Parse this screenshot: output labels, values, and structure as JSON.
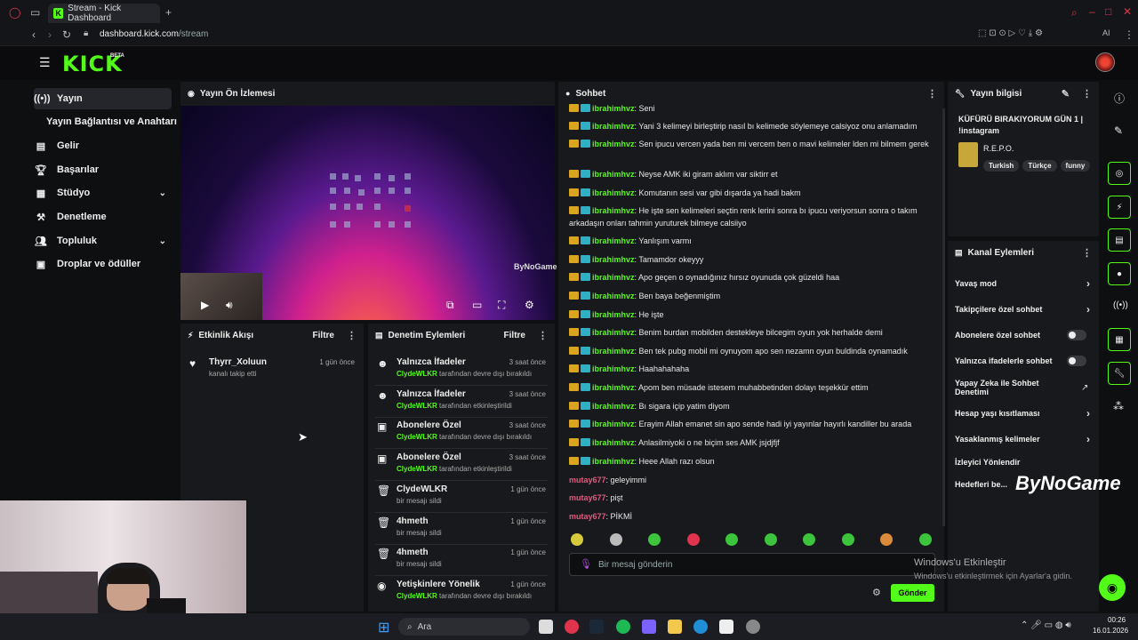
{
  "browser": {
    "tab_title": "Stream - Kick Dashboard",
    "url_domain": "dashboard.kick.com",
    "url_path": "/stream"
  },
  "header": {
    "logo": "KICK",
    "badge": "BETA"
  },
  "sidebar": {
    "items": [
      {
        "label": "Yayın",
        "icon": "broadcast-icon",
        "active": true
      },
      {
        "label": "Yayın Bağlantısı ve Anahtarı",
        "icon": "",
        "active": false
      },
      {
        "label": "Gelir",
        "icon": "chart-icon",
        "active": false
      },
      {
        "label": "Başarılar",
        "icon": "trophy-icon",
        "active": false
      },
      {
        "label": "Stüdyo",
        "icon": "studio-icon",
        "active": false
      },
      {
        "label": "Denetleme",
        "icon": "hammer-icon",
        "active": false
      },
      {
        "label": "Topluluk",
        "icon": "community-icon",
        "active": false
      },
      {
        "label": "Droplar ve ödüller",
        "icon": "gift-icon",
        "active": false
      }
    ]
  },
  "preview": {
    "title": "Yayın Ön İzlemesi",
    "watermark": "ByNoGame"
  },
  "activity": {
    "title": "Etkinlik Akışı",
    "filter_label": "Filtre",
    "items": [
      {
        "user": "Thyrr_Xoluun",
        "desc": "kanalı takip etti",
        "time": "1 gün önce",
        "icon": "heart-icon"
      }
    ]
  },
  "moderation": {
    "title": "Denetim Eylemleri",
    "filter_label": "Filtre",
    "items": [
      {
        "title": "Yalnızca İfadeler",
        "by": "ClydeWLKR",
        "action": "tarafından devre dışı bırakıldı",
        "time": "3 saat önce",
        "icon": "smiley-icon"
      },
      {
        "title": "Yalnızca İfadeler",
        "by": "ClydeWLKR",
        "action": "tarafından etkinleştirildi",
        "time": "3 saat önce",
        "icon": "smiley-icon"
      },
      {
        "title": "Abonelere Özel",
        "by": "ClydeWLKR",
        "action": "tarafından devre dışı bırakıldı",
        "time": "3 saat önce",
        "icon": "gift-icon"
      },
      {
        "title": "Abonelere Özel",
        "by": "ClydeWLKR",
        "action": "tarafından etkinleştirildi",
        "time": "3 saat önce",
        "icon": "gift-icon"
      },
      {
        "title": "ClydeWLKR",
        "by": "",
        "action": "bir mesajı sildi",
        "time": "1 gün önce",
        "icon": "trash-icon"
      },
      {
        "title": "4hmeth",
        "by": "",
        "action": "bir mesajı sildi",
        "time": "1 gün önce",
        "icon": "trash-icon"
      },
      {
        "title": "4hmeth",
        "by": "",
        "action": "bir mesajı sildi",
        "time": "1 gün önce",
        "icon": "trash-icon"
      },
      {
        "title": "Yetişkinlere Yönelik",
        "by": "ClydeWLKR",
        "action": "tarafından devre dışı bırakıldı",
        "time": "1 gün önce",
        "icon": "eye-icon"
      }
    ]
  },
  "chat": {
    "title": "Sohbet",
    "input_placeholder": "Bir mesaj gönderin",
    "send_label": "Gönder",
    "messages": [
      {
        "user": "ibrahimhvz",
        "text": "Seni",
        "badges": true
      },
      {
        "user": "ibrahimhvz",
        "text": "Yani 3 kelimeyi birleştirip nasıl bı kelimede söylemeye calsiyoz onu anlamadım",
        "badges": true
      },
      {
        "user": "ibrahimhvz",
        "text": "Sen ipucu vercen yada ben mi vercem ben o mavi kelimeler lden mi bilmem gerek",
        "badges": true
      },
      {
        "user": "ibrahimhvz",
        "text": "Neyse AMK iki giram aklım var siktirr et",
        "badges": true
      },
      {
        "user": "ibrahimhvz",
        "text": "Komutanın sesi var gibi dışarda ya hadi bakm",
        "badges": true
      },
      {
        "user": "ibrahimhvz",
        "text": "He işte sen kelimeleri seçtin renk lerini sonra bı ipucu veriyorsun sonra o takım arkadaşın onları tahmin yuruturek bilmeye calsiiyo",
        "badges": true
      },
      {
        "user": "ibrahimhvz",
        "text": "Yanlışım varmı",
        "badges": true
      },
      {
        "user": "ibrahimhvz",
        "text": "Tamamdor okeyyy",
        "badges": true
      },
      {
        "user": "ibrahimhvz",
        "text": "Apo geçen o oynadığınız hırsız oyunuda çok güzeldi haa",
        "badges": true
      },
      {
        "user": "ibrahimhvz",
        "text": "Ben baya beğenmiştim",
        "badges": true
      },
      {
        "user": "ibrahimhvz",
        "text": "He işte",
        "badges": true
      },
      {
        "user": "ibrahimhvz",
        "text": "Benim burdan mobilden destekleye bilcegim oyun yok herhalde demi",
        "badges": true
      },
      {
        "user": "ibrahimhvz",
        "text": "Ben tek pubg mobil mi oynuyom apo sen nezamn oyun buldinda oynamadık",
        "badges": true
      },
      {
        "user": "ibrahimhvz",
        "text": "Haahahahaha",
        "badges": true
      },
      {
        "user": "ibrahimhvz",
        "text": "Apom ben müsade istesem muhabbetinden dolayı teşekkür ettim",
        "badges": true
      },
      {
        "user": "ibrahimhvz",
        "text": "Bı sigara içip yatim diyom",
        "badges": true
      },
      {
        "user": "ibrahimhvz",
        "text": "Erayim Allah emanet sin apo sende hadi iyi yayınlar hayırlı kandiller bu arada",
        "badges": true
      },
      {
        "user": "ibrahimhvz",
        "text": "Anlasilmiyoki o ne biçim ses AMK jsjdjfjf",
        "badges": true
      },
      {
        "user": "ibrahimhvz",
        "text": "Heee Allah razı olsun",
        "badges": true
      },
      {
        "user": "mutay677",
        "text": "geleyimmi",
        "badges": false
      },
      {
        "user": "mutay677",
        "text": "pişt",
        "badges": false
      },
      {
        "user": "mutay677",
        "text": "PİKMİ",
        "badges": false
      }
    ]
  },
  "stream_info": {
    "title": "Yayın bilgisi",
    "stream_title": "KÜFÜRÜ BIRAKIYORUM GÜN 1 | !instagram",
    "category": "R.E.P.O.",
    "tags": [
      "Turkish",
      "Türkçe",
      "funny"
    ]
  },
  "channel_actions": {
    "title": "Kanal Eylemleri",
    "rows": [
      {
        "label": "Yavaş mod",
        "control": "arrow"
      },
      {
        "label": "Takipçilere özel sohbet",
        "control": "arrow"
      },
      {
        "label": "Abonelere özel sohbet",
        "control": "toggle"
      },
      {
        "label": "Yalnızca ifadelerle sohbet",
        "control": "toggle"
      },
      {
        "label": "Yapay Zeka ile Sohbet Denetimi",
        "control": "external"
      },
      {
        "label": "Hesap yaşı kısıtlaması",
        "control": "arrow"
      },
      {
        "label": "Yasaklanmış kelimeler",
        "control": "arrow"
      },
      {
        "label": "İzleyici Yönlendir",
        "control": "none"
      },
      {
        "label": "Hedefleri be...",
        "control": "none"
      }
    ]
  },
  "overlay": {
    "watermark": "ByNoGame",
    "activation_title": "Windows'u Etkinleştir",
    "activation_sub": "Windows'u etkinleştirmek için Ayarlar'a gidin."
  },
  "taskbar": {
    "search_label": "Ara",
    "time": "00:26",
    "date": "16.01.2026"
  },
  "colors": {
    "accent": "#53fc18",
    "panel": "#18191c",
    "bg": "#0e0f11",
    "username_alt": "#e05a7e"
  }
}
